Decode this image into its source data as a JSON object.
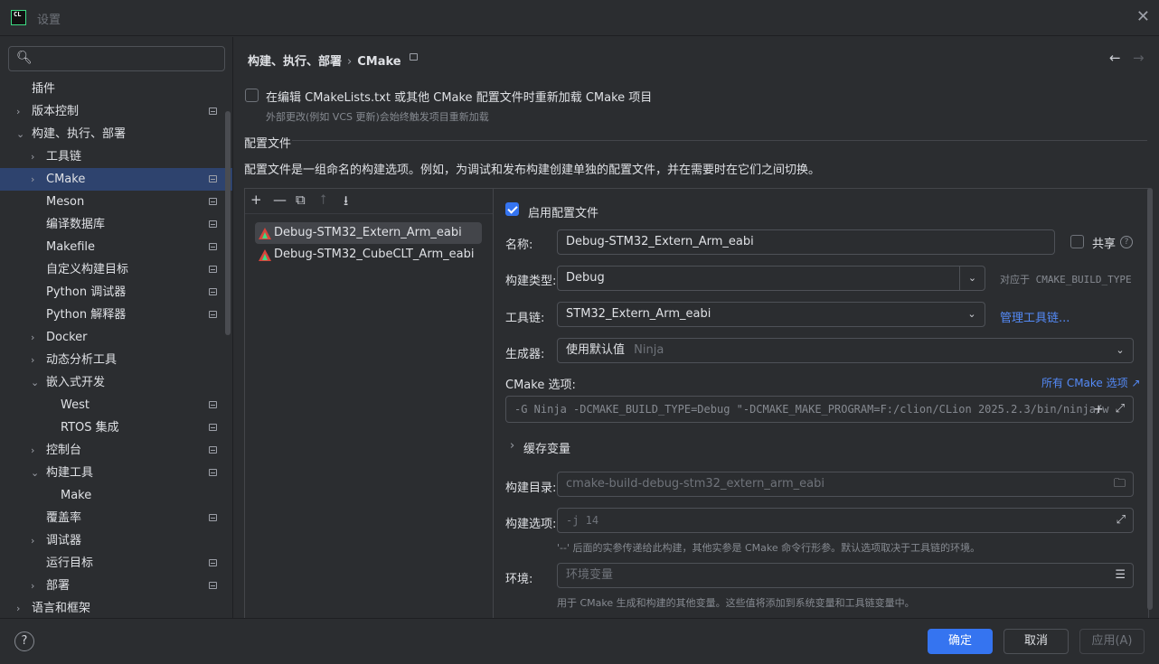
{
  "window": {
    "logo": "CL",
    "title": "设置"
  },
  "search": {
    "placeholder": "",
    "icon": "search-icon"
  },
  "sidebar": {
    "items": [
      {
        "label": "插件",
        "level": 0,
        "chevron": "",
        "proj": false,
        "selected": false
      },
      {
        "label": "版本控制",
        "level": 0,
        "chevron": "›",
        "proj": true,
        "selected": false
      },
      {
        "label": "构建、执行、部署",
        "level": 0,
        "chevron": "⌄",
        "proj": false,
        "selected": false
      },
      {
        "label": "工具链",
        "level": 1,
        "chevron": "›",
        "proj": false,
        "selected": false
      },
      {
        "label": "CMake",
        "level": 1,
        "chevron": "›",
        "proj": true,
        "selected": true
      },
      {
        "label": "Meson",
        "level": 1,
        "chevron": "",
        "proj": true,
        "selected": false
      },
      {
        "label": "编译数据库",
        "level": 1,
        "chevron": "",
        "proj": true,
        "selected": false
      },
      {
        "label": "Makefile",
        "level": 1,
        "chevron": "",
        "proj": true,
        "selected": false
      },
      {
        "label": "自定义构建目标",
        "level": 1,
        "chevron": "",
        "proj": true,
        "selected": false
      },
      {
        "label": "Python 调试器",
        "level": 1,
        "chevron": "",
        "proj": true,
        "selected": false
      },
      {
        "label": "Python 解释器",
        "level": 1,
        "chevron": "",
        "proj": true,
        "selected": false
      },
      {
        "label": "Docker",
        "level": 1,
        "chevron": "›",
        "proj": false,
        "selected": false
      },
      {
        "label": "动态分析工具",
        "level": 1,
        "chevron": "›",
        "proj": false,
        "selected": false
      },
      {
        "label": "嵌入式开发",
        "level": 1,
        "chevron": "⌄",
        "proj": false,
        "selected": false
      },
      {
        "label": "West",
        "level": 2,
        "chevron": "",
        "proj": true,
        "selected": false
      },
      {
        "label": "RTOS 集成",
        "level": 2,
        "chevron": "",
        "proj": true,
        "selected": false
      },
      {
        "label": "控制台",
        "level": 1,
        "chevron": "›",
        "proj": true,
        "selected": false
      },
      {
        "label": "构建工具",
        "level": 1,
        "chevron": "⌄",
        "proj": true,
        "selected": false
      },
      {
        "label": "Make",
        "level": 2,
        "chevron": "",
        "proj": false,
        "selected": false
      },
      {
        "label": "覆盖率",
        "level": 1,
        "chevron": "",
        "proj": true,
        "selected": false
      },
      {
        "label": "调试器",
        "level": 1,
        "chevron": "›",
        "proj": false,
        "selected": false
      },
      {
        "label": "运行目标",
        "level": 1,
        "chevron": "",
        "proj": true,
        "selected": false
      },
      {
        "label": "部署",
        "level": 1,
        "chevron": "›",
        "proj": true,
        "selected": false
      },
      {
        "label": "语言和框架",
        "level": 0,
        "chevron": "›",
        "proj": false,
        "selected": false
      }
    ]
  },
  "breadcrumb": {
    "parent": "构建、执行、部署",
    "sep": "›",
    "current": "CMake"
  },
  "reload": {
    "label": "在编辑 CMakeLists.txt 或其他 CMake 配置文件时重新加载 CMake 项目",
    "hint": "外部更改(例如 VCS 更新)会始终触发项目重新加载",
    "checked": false
  },
  "profiles_section": {
    "title": "配置文件",
    "description": "配置文件是一组命名的构建选项。例如，为调试和发布构建创建单独的配置文件，并在需要时在它们之间切换。"
  },
  "toolbar": {
    "add": "+",
    "remove": "—",
    "copy": "⧉",
    "up": "⭡",
    "down": "⭳"
  },
  "profiles": [
    {
      "name": "Debug-STM32_Extern_Arm_eabi",
      "selected": true
    },
    {
      "name": "Debug-STM32_CubeCLT_Arm_eabi",
      "selected": false
    }
  ],
  "details": {
    "enable_label": "启用配置文件",
    "name_label": "名称:",
    "name_value": "Debug-STM32_Extern_Arm_eabi",
    "share_label": "共享",
    "build_type_label": "构建类型:",
    "build_type_value": "Debug",
    "build_type_hint": "对应于 CMAKE_BUILD_TYPE",
    "toolchain_label": "工具链:",
    "toolchain_value": "STM32_Extern_Arm_eabi",
    "manage_toolchains": "管理工具链...",
    "generator_label": "生成器:",
    "generator_value": "使用默认值",
    "generator_default": "Ninja",
    "cmake_options_label": "CMake 选项:",
    "all_cmake_options": "所有 CMake 选项 ↗",
    "cmake_options_value": "-G Ninja -DCMAKE_BUILD_TYPE=Debug \"-DCMAKE_MAKE_PROGRAM=F:/clion/CLion 2025.2.3/bin/ninja/w",
    "cache_vars_label": "缓存变量",
    "build_dir_label": "构建目录:",
    "build_dir_value": "cmake-build-debug-stm32_extern_arm_eabi",
    "build_options_label": "构建选项:",
    "build_options_value": "-j 14",
    "build_options_hint": "'--' 后面的实参传递给此构建，其他实参是 CMake 命令行形参。默认选项取决于工具链的环境。",
    "env_label": "环境:",
    "env_placeholder": "环境变量",
    "env_hint": "用于 CMake 生成和构建的其他变量。这些值将添加到系统变量和工具链变量中。"
  },
  "footer": {
    "help": "?",
    "ok": "确定",
    "cancel": "取消",
    "apply": "应用(A)"
  },
  "colors": {
    "accent": "#3574f0",
    "background": "#2b2d30",
    "link": "#548af7",
    "selection": "#2e436e"
  }
}
